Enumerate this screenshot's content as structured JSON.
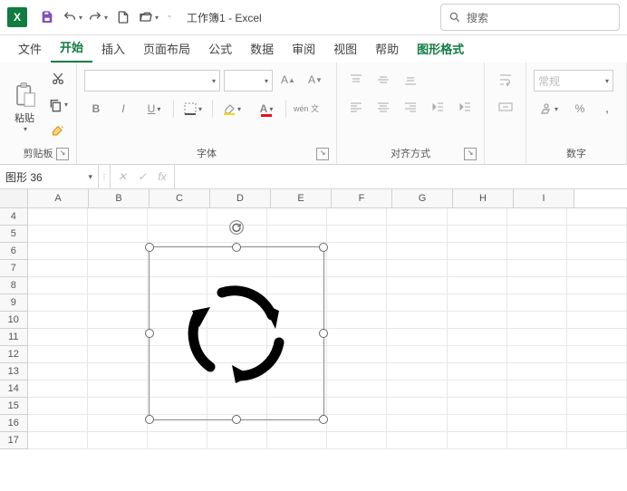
{
  "titlebar": {
    "doc_title": "工作簿1 - Excel",
    "search_placeholder": "搜索"
  },
  "tabs": {
    "file": "文件",
    "home": "开始",
    "insert": "插入",
    "layout": "页面布局",
    "formulas": "公式",
    "data": "数据",
    "review": "审阅",
    "view": "视图",
    "help": "帮助",
    "shape_format": "图形格式"
  },
  "ribbon": {
    "clipboard": {
      "paste": "粘贴",
      "label": "剪贴板"
    },
    "font": {
      "label": "字体",
      "bold": "B",
      "italic": "I",
      "underline": "U",
      "wen": "wén 文"
    },
    "align": {
      "label": "对齐方式"
    },
    "number": {
      "label": "数字",
      "format": "常规",
      "percent": "%"
    }
  },
  "formula_bar": {
    "name_box": "图形 36",
    "fx": "fx"
  },
  "grid": {
    "cols": [
      "A",
      "B",
      "C",
      "D",
      "E",
      "F",
      "G",
      "H",
      "I"
    ],
    "rows": [
      "4",
      "5",
      "6",
      "7",
      "8",
      "9",
      "10",
      "11",
      "12",
      "13",
      "14",
      "15",
      "16",
      "17"
    ]
  }
}
